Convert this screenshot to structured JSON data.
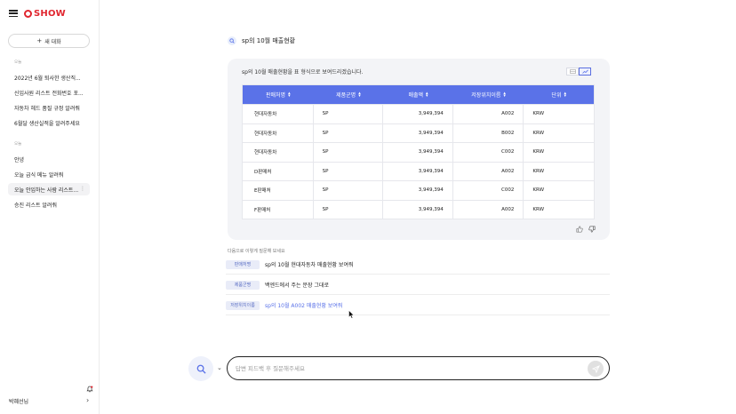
{
  "sidebar": {
    "brand": "SHOW",
    "new_chat_label": "새 대화",
    "section_1_label": "오늘",
    "section_1_items": [
      "2022년 6월 퇴사한 생산직...",
      "신입사원 리스트 전화번호 포...",
      "자동차 헤드 품질 규정 알려줘",
      "6월달 생산실적을 알려주세요"
    ],
    "section_2_label": "오늘",
    "section_2_items": [
      "안녕",
      "오늘 급식 메뉴 알려줘",
      "오늘 안입하는 사람 리스트...",
      "승진 리스트 알려줘"
    ],
    "user_name": "박혜선님"
  },
  "question": {
    "text": "sp의 10월 매출현황"
  },
  "answer": {
    "intro": "sp의 10월 매출현황을 표 형식으로 보여드리겠습니다.",
    "table": {
      "headers": [
        "판매처명",
        "제품군명",
        "매출액",
        "저장위치이름",
        "단위"
      ],
      "rows": [
        [
          "현대자동차",
          "SP",
          "3,949,394",
          "A002",
          "KRW"
        ],
        [
          "현대자동차",
          "SP",
          "3,949,394",
          "B002",
          "KRW"
        ],
        [
          "현대자동차",
          "SP",
          "3,949,394",
          "C002",
          "KRW"
        ],
        [
          "D판매처",
          "SP",
          "3,949,394",
          "A002",
          "KRW"
        ],
        [
          "E판매처",
          "SP",
          "3,949,394",
          "C002",
          "KRW"
        ],
        [
          "F판매처",
          "SP",
          "3,949,394",
          "A002",
          "KRW"
        ]
      ]
    }
  },
  "suggestions": {
    "title": "다음으로 이렇게 질문해 보세요",
    "items": [
      {
        "tag": "판매처명",
        "text": "sp의 10월 현대자동차 매출현황 보여줘"
      },
      {
        "tag": "제품군명",
        "text": "백엔드에서 주는 문장 그대로"
      },
      {
        "tag": "저장위치이름",
        "text": "sp의 10월 A002 매출현황 보여줘"
      }
    ]
  },
  "input": {
    "placeholder": "답변 피드백 후 질문해주세요",
    "value": ""
  },
  "colors": {
    "accent": "#5a72e8",
    "brand": "#e0262f",
    "panel": "#f3f4f7"
  }
}
